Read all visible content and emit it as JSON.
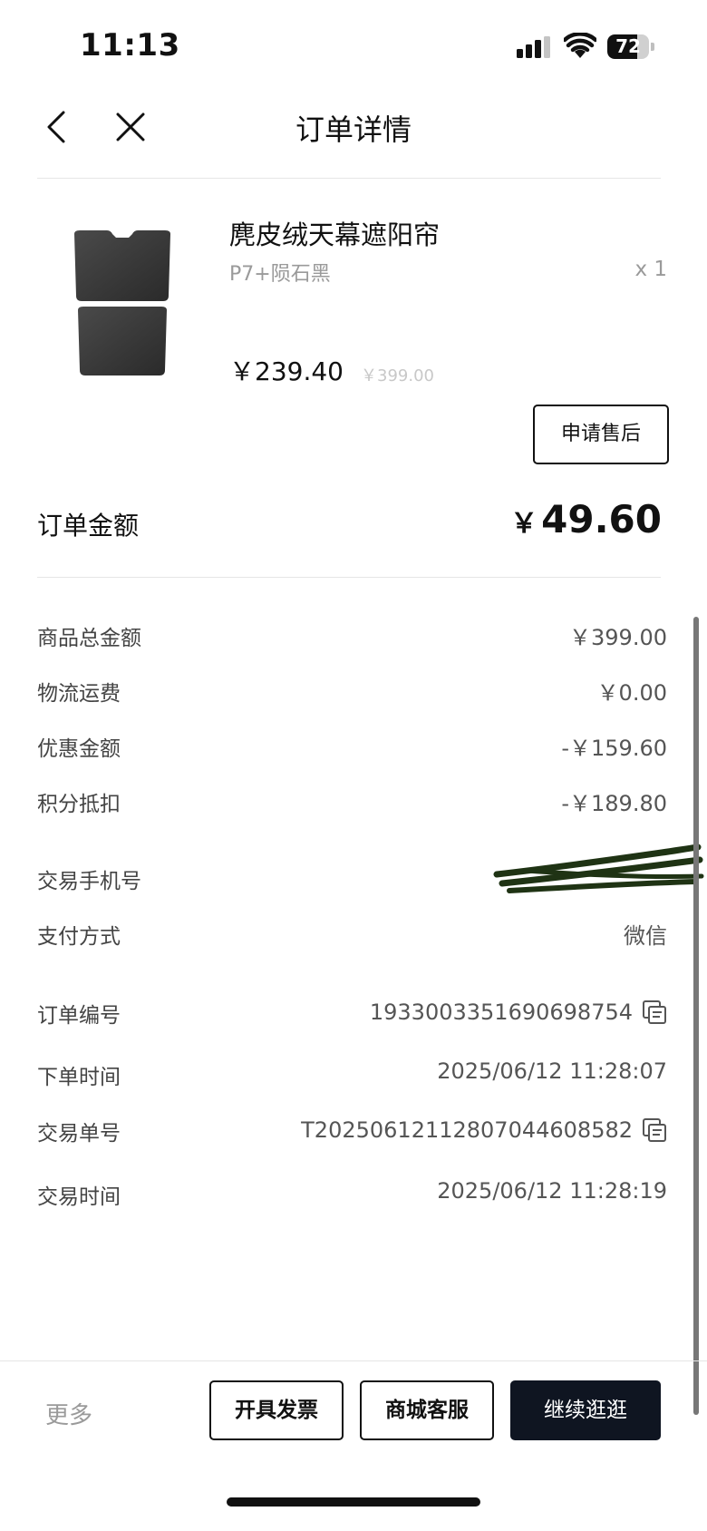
{
  "status_bar": {
    "time": "11:13",
    "battery_level": "72"
  },
  "nav": {
    "title": "订单详情"
  },
  "product": {
    "name": "麂皮绒天幕遮阳帘",
    "variant": "P7+陨石黑",
    "quantity": "x 1",
    "price": "￥239.40",
    "original_price": "￥399.00",
    "after_sale_button": "申请售后"
  },
  "order_total": {
    "label": "订单金额",
    "currency": "￥",
    "amount": "49.60"
  },
  "price_rows": [
    {
      "label": "商品总金额",
      "value": "￥399.00"
    },
    {
      "label": "物流运费",
      "value": "￥0.00"
    },
    {
      "label": "优惠金额",
      "value": "-￥159.60"
    },
    {
      "label": "积分抵扣",
      "value": "-￥189.80"
    }
  ],
  "payment_rows": [
    {
      "label": "交易手机号",
      "value": ""
    },
    {
      "label": "支付方式",
      "value": "微信"
    }
  ],
  "order_info": [
    {
      "label": "订单编号",
      "value": "1933003351690698754"
    },
    {
      "label": "下单时间",
      "value": "2025/06/12 11:28:07"
    },
    {
      "label": "交易单号",
      "value": "T2025061211280704460858​2"
    },
    {
      "label": "交易时间",
      "value": "2025/06/12 11:28:19"
    }
  ],
  "bottom_bar": {
    "more": "更多",
    "invoice_button": "开具发票",
    "service_button": "商城客服",
    "continue_button": "继续逛逛"
  }
}
